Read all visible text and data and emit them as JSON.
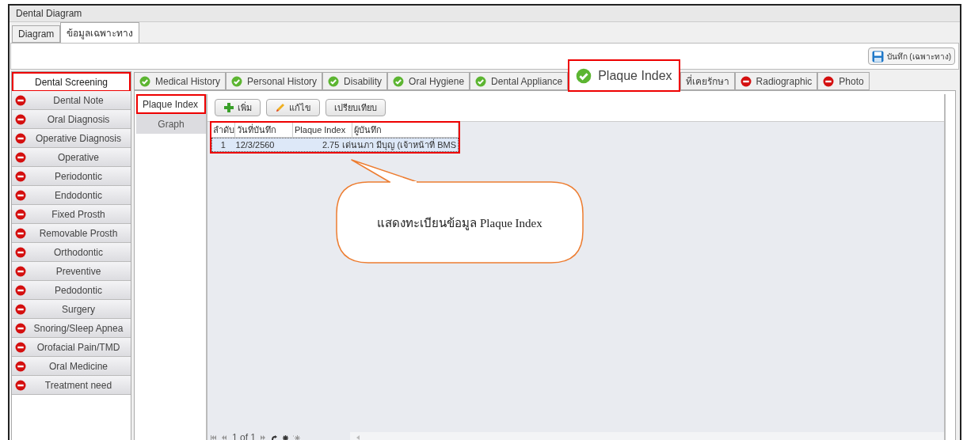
{
  "window": {
    "title": "Dental Diagram"
  },
  "top_tabs": [
    {
      "label": "Diagram",
      "selected": false
    },
    {
      "label": "ข้อมูลเฉพาะทาง",
      "selected": true
    }
  ],
  "save_button": {
    "label": "บันทึก (เฉพาะทาง)"
  },
  "sidebar": {
    "items": [
      {
        "label": "Dental Screening",
        "kind": "plain",
        "selected": true
      },
      {
        "label": "Dental Note",
        "kind": "missing",
        "selected": false
      },
      {
        "label": "Oral Diagnosis",
        "kind": "missing",
        "selected": false
      },
      {
        "label": "Operative Diagnosis",
        "kind": "missing",
        "selected": false
      },
      {
        "label": "Operative",
        "kind": "missing",
        "selected": false
      },
      {
        "label": "Periodontic",
        "kind": "missing",
        "selected": false
      },
      {
        "label": "Endodontic",
        "kind": "missing",
        "selected": false
      },
      {
        "label": "Fixed Prosth",
        "kind": "missing",
        "selected": false
      },
      {
        "label": "Removable Prosth",
        "kind": "missing",
        "selected": false
      },
      {
        "label": "Orthodontic",
        "kind": "missing",
        "selected": false
      },
      {
        "label": "Preventive",
        "kind": "missing",
        "selected": false
      },
      {
        "label": "Pedodontic",
        "kind": "missing",
        "selected": false
      },
      {
        "label": "Surgery",
        "kind": "missing",
        "selected": false
      },
      {
        "label": "Snoring/Sleep Apnea",
        "kind": "missing",
        "selected": false
      },
      {
        "label": "Orofacial Pain/TMD",
        "kind": "missing",
        "selected": false
      },
      {
        "label": "Oral Medicine",
        "kind": "missing",
        "selected": false
      },
      {
        "label": "Treatment need",
        "kind": "missing",
        "selected": false
      }
    ]
  },
  "tabs": [
    {
      "label": "Medical History",
      "kind": "done",
      "selected": false
    },
    {
      "label": "Personal History",
      "kind": "done",
      "selected": false
    },
    {
      "label": "Disability",
      "kind": "done",
      "selected": false
    },
    {
      "label": "Oral Hygiene",
      "kind": "done",
      "selected": false
    },
    {
      "label": "Dental Appliance",
      "kind": "done",
      "selected": false
    },
    {
      "label": "Plaque Index",
      "kind": "done",
      "selected": true
    },
    {
      "label": "ที่เคยรักษา",
      "kind": "plain",
      "selected": false
    },
    {
      "label": "Radiographic",
      "kind": "missing",
      "selected": false
    },
    {
      "label": "Photo",
      "kind": "missing",
      "selected": false
    }
  ],
  "sub_nav": [
    {
      "label": "Plaque Index",
      "selected": true
    },
    {
      "label": "Graph",
      "selected": false
    }
  ],
  "toolbar": [
    {
      "label": "เพิ่ม",
      "kind": "add"
    },
    {
      "label": "แก้ไข",
      "kind": "edit"
    },
    {
      "label": "เปรียบเทียบ",
      "kind": "plain"
    }
  ],
  "table": {
    "highlighted": true,
    "columns": [
      "ลำดับ",
      "วันที่บันทึก",
      "Plaque Index",
      "ผู้บันทึก"
    ],
    "rows": [
      {
        "cells": [
          "1",
          "12/3/2560",
          "2.75",
          "เด่นนภา  มีบุญ (เจ้าหน้าที่ BMS"
        ],
        "selected": true
      }
    ]
  },
  "navigator": {
    "position": "1 of 1"
  },
  "callout": {
    "text": "แสดงทะเบียนข้อมูล Plaque Index"
  }
}
